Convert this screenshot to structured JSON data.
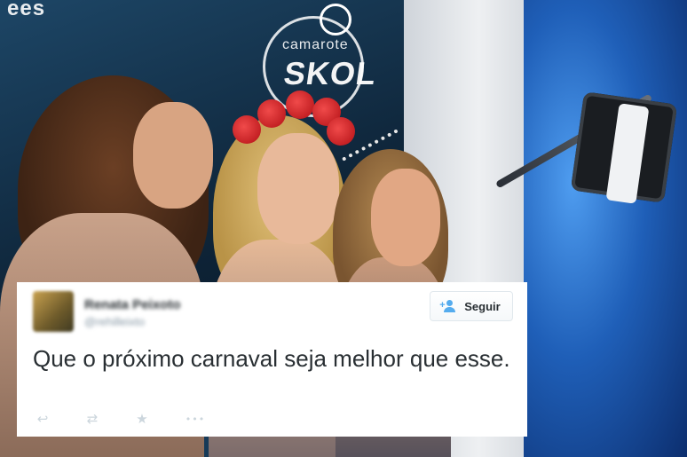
{
  "photo": {
    "brand_top": "ees",
    "logo_line1": "camarote",
    "logo_line2": "SKOL"
  },
  "tweet": {
    "user": {
      "name": "Renata Peixoto",
      "handle": "@rehilleixto"
    },
    "follow_button_label": "Seguir",
    "text": "Que o próximo carnaval seja melhor que esse.",
    "actions": [
      {
        "name": "reply-icon",
        "glyph": "↩"
      },
      {
        "name": "retweet-icon",
        "glyph": "⇄"
      },
      {
        "name": "favorite-icon",
        "glyph": "★"
      },
      {
        "name": "more-icon",
        "glyph": "•••"
      }
    ]
  },
  "colors": {
    "accent": "#55acee",
    "text": "#292f33",
    "muted": "#8899a6",
    "icon_inactive": "#ccd6dd"
  }
}
